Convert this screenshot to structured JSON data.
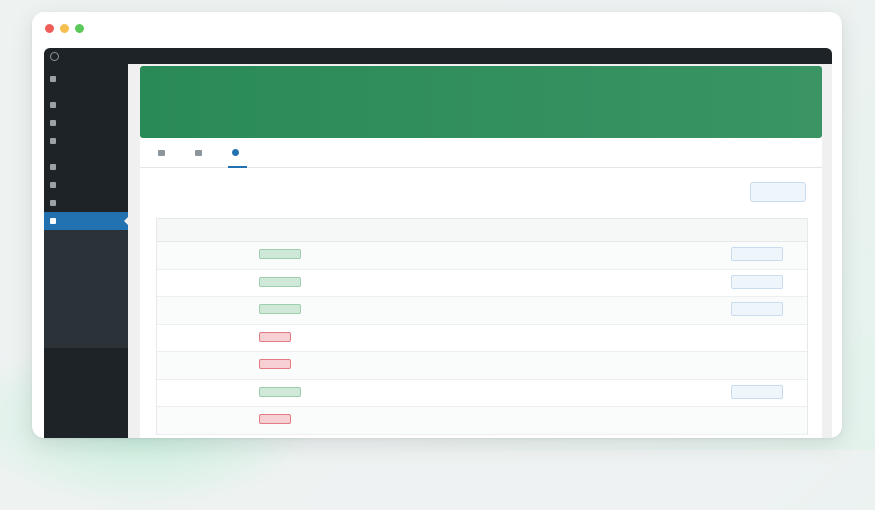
{
  "window": {
    "controls": [
      "close",
      "minimize",
      "maximize"
    ],
    "colors": {
      "close": "#ee5d58",
      "minimize": "#f5bf4f",
      "maximize": "#5cc85a"
    }
  },
  "admin_bar": {
    "items": [
      "",
      "",
      "",
      ""
    ]
  },
  "sidebar": {
    "items": [
      {
        "label": "",
        "icon": "dashboard-icon"
      },
      {
        "label": "",
        "icon": "posts-icon"
      },
      {
        "label": "",
        "icon": "media-icon"
      },
      {
        "label": "",
        "icon": "pages-icon"
      },
      {
        "label": "",
        "icon": "appearance-icon"
      },
      {
        "label": "",
        "icon": "plugins-icon"
      },
      {
        "label": "",
        "icon": "tools-icon"
      },
      {
        "label": "",
        "icon": "plugin-active-icon",
        "active": true
      }
    ],
    "submenu": [
      "",
      "",
      "",
      "",
      "",
      "",
      "",
      ""
    ]
  },
  "hero": {
    "title": "",
    "subtitle": "",
    "color": "#2e8b57"
  },
  "tabs": [
    {
      "label": "",
      "icon": "settings-icon"
    },
    {
      "label": "",
      "icon": "template-icon"
    },
    {
      "label": "",
      "icon": "logs-icon",
      "active": true
    }
  ],
  "logs": {
    "title": "",
    "clear_label": "",
    "columns": [
      "",
      "",
      "",
      ""
    ],
    "rows": [
      {
        "timestamp": "",
        "status": "success",
        "message": "",
        "has_view": true
      },
      {
        "timestamp": "",
        "status": "success",
        "message": "",
        "has_view": true
      },
      {
        "timestamp": "",
        "status": "success",
        "message": "",
        "has_view": true
      },
      {
        "timestamp": "",
        "status": "failed",
        "message": "",
        "has_view": false
      },
      {
        "timestamp": "",
        "status": "failed",
        "message": "",
        "has_view": false
      },
      {
        "timestamp": "",
        "status": "success",
        "message": "",
        "has_view": true
      },
      {
        "timestamp": "",
        "status": "failed",
        "message": "",
        "has_view": false
      }
    ],
    "view_label": ""
  },
  "accent": "#2271b1"
}
